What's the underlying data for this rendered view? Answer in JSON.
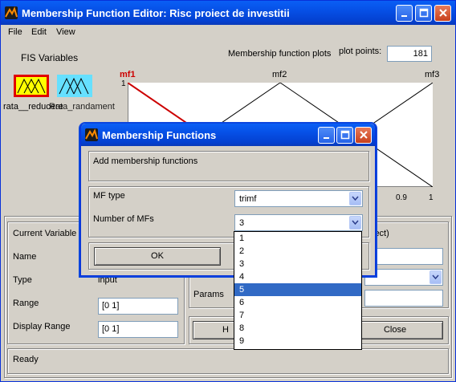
{
  "window": {
    "title": "Membership Function Editor: Risc proiect de investitii"
  },
  "menu": {
    "items": [
      "File",
      "Edit",
      "View"
    ]
  },
  "fis": {
    "header": "FIS Variables",
    "var1_label": "rata__reducere",
    "var2_label": "Rata_randament",
    "selected_var": 0
  },
  "plot": {
    "label": "Membership function plots",
    "points_label": "plot points:",
    "points_value": "181",
    "mf_labels": [
      "mf1",
      "mf2",
      "mf3"
    ],
    "y_tick": "1",
    "x_ticks": [
      "0.9",
      "1"
    ],
    "accent": "#cc0000"
  },
  "current_variable": {
    "header": "Current Variable",
    "name_label": "Name",
    "type_label": "Type",
    "type_value": "input",
    "range_label": "Range",
    "range_value": "[0 1]",
    "display_range_label": "Display Range",
    "display_range_value": "[0 1]"
  },
  "current_mf": {
    "header_tail": "lect)",
    "params_label": "Params",
    "help_button_partial": "H",
    "close_button": "Close"
  },
  "status": {
    "text": "Ready"
  },
  "dialog": {
    "title": "Membership Functions",
    "prompt": "Add membership functions",
    "mf_type_label": "MF type",
    "mf_type_value": "trimf",
    "num_mfs_label": "Number of MFs",
    "num_mfs_value": "3",
    "ok_button": "OK",
    "num_options": [
      "1",
      "2",
      "3",
      "4",
      "5",
      "6",
      "7",
      "8",
      "9"
    ],
    "highlighted_option": "5",
    "highlight_color": "#316ac5"
  }
}
